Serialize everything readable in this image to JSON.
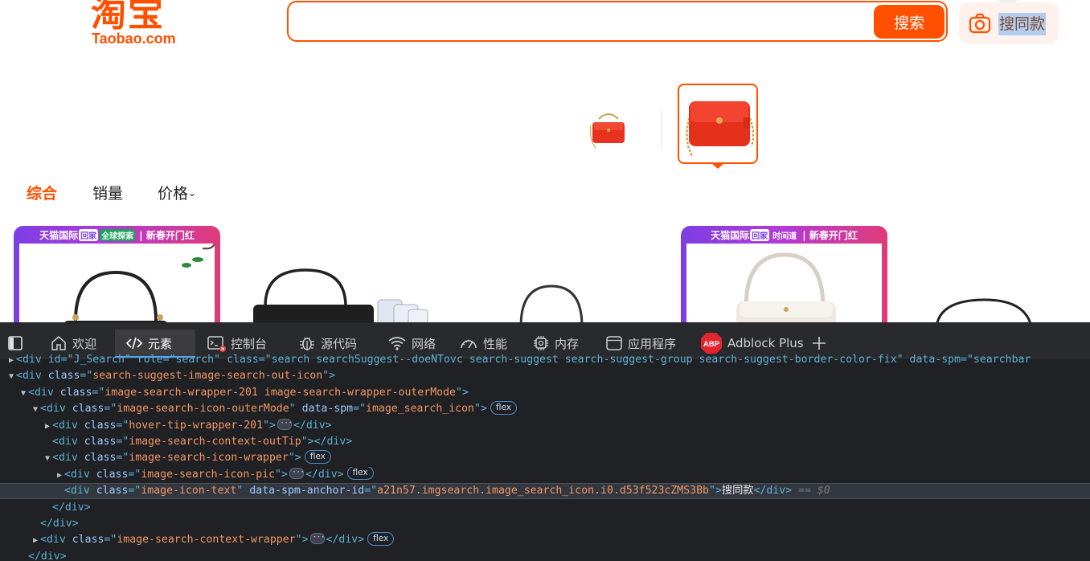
{
  "header": {
    "logo_cn": "淘宝",
    "logo_en": "Taobao.com",
    "search_value": "",
    "search_button": "搜索",
    "image_search_label": "搜同款"
  },
  "sort_tabs": [
    {
      "label": "综合",
      "active": true
    },
    {
      "label": "销量",
      "active": false
    },
    {
      "label": "价格",
      "active": false
    }
  ],
  "promo_cards": [
    {
      "prefix": "天猫国际",
      "badge1": "回家",
      "badge2": "全球探索",
      "suffix": "新春开门红"
    },
    {
      "prefix": "天猫国际",
      "badge1": "回家",
      "badge2": "时间道",
      "suffix": "新春开门红"
    }
  ],
  "devtools": {
    "tabs": [
      {
        "label": "欢迎",
        "icon": "home-icon"
      },
      {
        "label": "元素",
        "icon": "code-icon",
        "active": true
      },
      {
        "label": "控制台",
        "icon": "console-icon"
      },
      {
        "label": "源代码",
        "icon": "bug-icon"
      },
      {
        "label": "网络",
        "icon": "wifi-icon"
      },
      {
        "label": "性能",
        "icon": "gauge-icon"
      },
      {
        "label": "内存",
        "icon": "chip-icon"
      },
      {
        "label": "应用程序",
        "icon": "app-icon"
      },
      {
        "label": "Adblock Plus",
        "icon": "abp-icon"
      }
    ],
    "abp_logo": "ABP",
    "dom_lines": [
      {
        "indent": 1,
        "toggle": "▶",
        "text": "<div id=\"J_Search\" role=\"search\" class=\"search searchSuggest--doeNTovc search-suggest search-suggest-group search-suggest-border-color-fix\" data-spm=\"searchbar"
      },
      {
        "indent": 1,
        "toggle": "▼",
        "tag": "div",
        "attrs": [
          [
            "class",
            "search-suggest-image-search-out-icon"
          ]
        ],
        "close": false
      },
      {
        "indent": 2,
        "toggle": "▼",
        "tag": "div",
        "attrs": [
          [
            "class",
            "image-search-wrapper-201 image-search-wrapper-outerMode"
          ]
        ],
        "close": false
      },
      {
        "indent": 3,
        "toggle": "▼",
        "tag": "div",
        "attrs": [
          [
            "class",
            "image-search-icon-outerMode"
          ],
          [
            "data-spm",
            "image_search_icon"
          ]
        ],
        "close": false,
        "badge": "flex"
      },
      {
        "indent": 4,
        "toggle": "▶",
        "tag": "div",
        "attrs": [
          [
            "class",
            "hover-tip-wrapper-201"
          ]
        ],
        "ellipsis": true,
        "close": true
      },
      {
        "indent": 4,
        "toggle": "",
        "tag": "div",
        "attrs": [
          [
            "class",
            "image-search-context-outTip"
          ]
        ],
        "close": true
      },
      {
        "indent": 4,
        "toggle": "▼",
        "tag": "div",
        "attrs": [
          [
            "class",
            "image-search-icon-wrapper"
          ]
        ],
        "close": false,
        "badge": "flex"
      },
      {
        "indent": 5,
        "toggle": "▶",
        "tag": "div",
        "attrs": [
          [
            "class",
            "image-search-icon-pic"
          ]
        ],
        "ellipsis": true,
        "close": true,
        "badge": "flex"
      },
      {
        "indent": 5,
        "toggle": "",
        "tag": "div",
        "attrs": [
          [
            "class",
            "image-icon-text"
          ],
          [
            "data-spm-anchor-id",
            "a21n57.imgsearch.image_search_icon.i0.d53f523cZMS3Bb"
          ]
        ],
        "inner": "搜同款",
        "close": true,
        "selected": true,
        "suffix": "== $0"
      },
      {
        "indent": 4,
        "toggle": "",
        "closing": "div"
      },
      {
        "indent": 3,
        "toggle": "",
        "closing": "div"
      },
      {
        "indent": 3,
        "toggle": "▶",
        "tag": "div",
        "attrs": [
          [
            "class",
            "image-search-context-wrapper"
          ]
        ],
        "ellipsis": true,
        "close": true,
        "badge": "flex"
      },
      {
        "indent": 2,
        "toggle": "",
        "closing": "div"
      }
    ]
  },
  "colors": {
    "brand": "#ff5000",
    "devtools_bg": "#202124"
  }
}
